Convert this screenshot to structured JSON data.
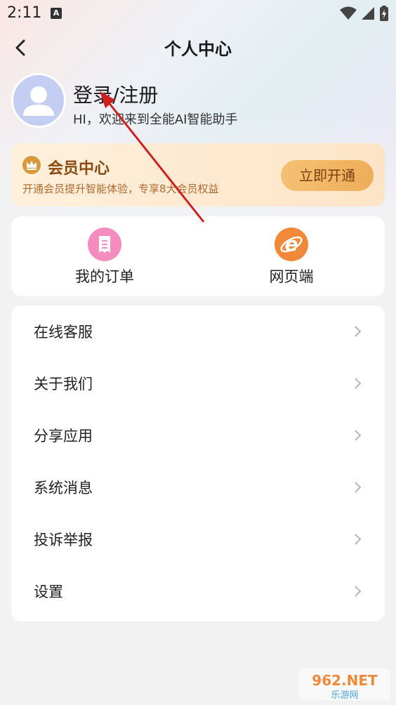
{
  "status_bar": {
    "time": "2:11",
    "notification_icon": "A",
    "icons": [
      "wifi-icon",
      "signal-icon",
      "battery-icon"
    ]
  },
  "header": {
    "title": "个人中心",
    "back_icon": "chevron-left-icon"
  },
  "profile": {
    "login_label": "登录/注册",
    "welcome_text": "HI，欢迎来到全能AI智能助手",
    "avatar_icon": "user-icon"
  },
  "vip": {
    "title": "会员中心",
    "subtitle": "开通会员提升智能体验，专享8大会员权益",
    "button_label": "立即开通",
    "icon": "crown-icon"
  },
  "quick_links": [
    {
      "label": "我的订单",
      "icon": "receipt-icon",
      "color": "#f277b5"
    },
    {
      "label": "网页端",
      "icon": "browser-e-icon",
      "color": "#f08a3a"
    }
  ],
  "menu": [
    {
      "label": "在线客服"
    },
    {
      "label": "关于我们"
    },
    {
      "label": "分享应用"
    },
    {
      "label": "系统消息"
    },
    {
      "label": "投诉举报"
    },
    {
      "label": "设置"
    }
  ],
  "watermark": {
    "brand": "962.NET",
    "sub": "乐游网"
  },
  "colors": {
    "vip_text": "#8a4a12",
    "vip_button": "#eeae58",
    "avatar_bg": "#c4cdf2",
    "annotation_arrow": "#d01f1f"
  }
}
